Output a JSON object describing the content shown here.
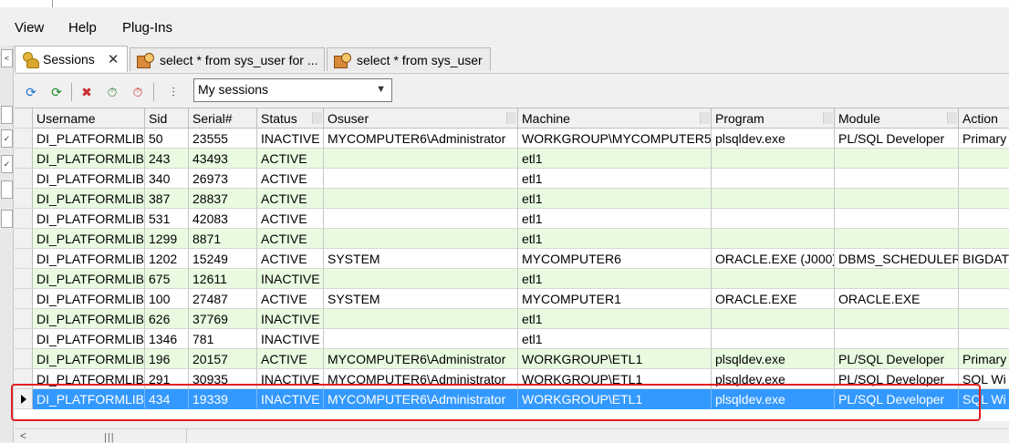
{
  "menubar": {
    "items": [
      "View",
      "Help",
      "Plug-Ins"
    ]
  },
  "tabs": [
    {
      "label": "Sessions",
      "icon": "sessions-icon",
      "active": true
    },
    {
      "label": "select * from sys_user for ...",
      "icon": "sql-window-icon"
    },
    {
      "label": "select * from sys_user",
      "icon": "sql-window-icon"
    }
  ],
  "toolbar": {
    "buttons": [
      {
        "name": "refresh-icon",
        "glyph": "⟳",
        "color": "#1a6fd1"
      },
      {
        "name": "auto-refresh-icon",
        "glyph": "⟳",
        "color": "#1a8a2a"
      },
      {
        "name": "kill-session-icon",
        "glyph": "✖",
        "color": "#c83030"
      },
      {
        "name": "timer-icon",
        "glyph": "⏱",
        "color": "#2a7a2a"
      },
      {
        "name": "timer-stop-icon",
        "glyph": "⏱",
        "color": "#c83030"
      },
      {
        "name": "filter-settings-icon",
        "glyph": "⫶",
        "color": "#333333"
      }
    ],
    "filter_select": {
      "value": "My sessions"
    }
  },
  "grid": {
    "columns": [
      "Username",
      "Sid",
      "Serial#",
      "Status",
      "Osuser",
      "Machine",
      "Program",
      "Module",
      "Action"
    ],
    "rows": [
      [
        "DI_PLATFORMLIB",
        "50",
        "23555",
        "INACTIVE",
        "MYCOMPUTER6\\Administrator",
        "WORKGROUP\\MYCOMPUTER5",
        "plsqldev.exe",
        "PL/SQL Developer",
        "Primary"
      ],
      [
        "DI_PLATFORMLIB",
        "243",
        "43493",
        "ACTIVE",
        "",
        "etl1",
        "",
        "",
        ""
      ],
      [
        "DI_PLATFORMLIB",
        "340",
        "26973",
        "ACTIVE",
        "",
        "etl1",
        "",
        "",
        ""
      ],
      [
        "DI_PLATFORMLIB",
        "387",
        "28837",
        "ACTIVE",
        "",
        "etl1",
        "",
        "",
        ""
      ],
      [
        "DI_PLATFORMLIB",
        "531",
        "42083",
        "ACTIVE",
        "",
        "etl1",
        "",
        "",
        ""
      ],
      [
        "DI_PLATFORMLIB",
        "1299",
        "8871",
        "ACTIVE",
        "",
        "etl1",
        "",
        "",
        ""
      ],
      [
        "DI_PLATFORMLIB",
        "1202",
        "15249",
        "ACTIVE",
        "SYSTEM",
        "MYCOMPUTER6",
        "ORACLE.EXE (J000)",
        "DBMS_SCHEDULER",
        "BIGDAT"
      ],
      [
        "DI_PLATFORMLIB",
        "675",
        "12611",
        "INACTIVE",
        "",
        "etl1",
        "",
        "",
        ""
      ],
      [
        "DI_PLATFORMLIB",
        "100",
        "27487",
        "ACTIVE",
        "SYSTEM",
        "MYCOMPUTER1",
        "ORACLE.EXE",
        "ORACLE.EXE",
        ""
      ],
      [
        "DI_PLATFORMLIB",
        "626",
        "37769",
        "INACTIVE",
        "",
        "etl1",
        "",
        "",
        ""
      ],
      [
        "DI_PLATFORMLIB",
        "1346",
        "781",
        "INACTIVE",
        "",
        "etl1",
        "",
        "",
        ""
      ],
      [
        "DI_PLATFORMLIB",
        "196",
        "20157",
        "ACTIVE",
        "MYCOMPUTER6\\Administrator",
        "WORKGROUP\\ETL1",
        "plsqldev.exe",
        "PL/SQL Developer",
        "Primary"
      ],
      [
        "DI_PLATFORMLIB",
        "291",
        "30935",
        "INACTIVE",
        "MYCOMPUTER6\\Administrator",
        "WORKGROUP\\ETL1",
        "plsqldev.exe",
        "PL/SQL Developer",
        "SQL Wi"
      ],
      [
        "DI_PLATFORMLIB",
        "434",
        "19339",
        "INACTIVE",
        "MYCOMPUTER6\\Administrator",
        "WORKGROUP\\ETL1",
        "plsqldev.exe",
        "PL/SQL Developer",
        "SQL Wi"
      ]
    ],
    "selected_row": 13
  },
  "colors": {
    "row_green": "#e8fbe0",
    "row_white": "#ffffff",
    "selection": "#3399ff",
    "highlight_box": "#e02020"
  }
}
